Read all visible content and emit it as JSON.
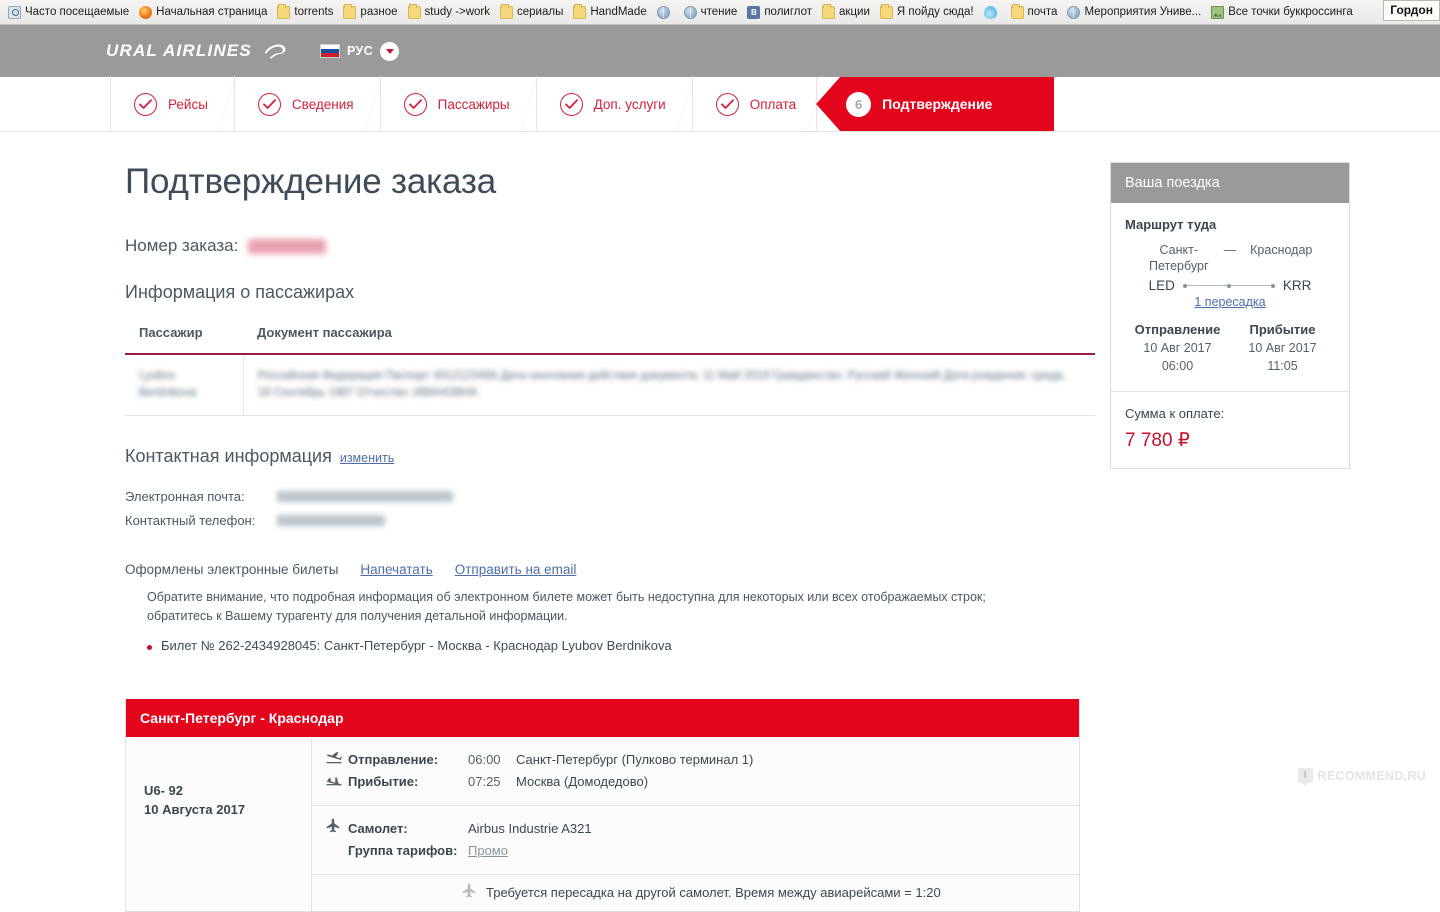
{
  "browser": {
    "bookmarks": [
      {
        "label": "Часто посещаемые",
        "icon": "frequent-icon"
      },
      {
        "label": "Начальная страница",
        "icon": "firefox-icon"
      },
      {
        "label": "torrents",
        "icon": "folder-icon"
      },
      {
        "label": "разное",
        "icon": "folder-icon"
      },
      {
        "label": "study ->work",
        "icon": "folder-icon"
      },
      {
        "label": "сериалы",
        "icon": "folder-icon"
      },
      {
        "label": "HandMade",
        "icon": "folder-icon"
      },
      {
        "label": "",
        "icon": "globe-icon"
      },
      {
        "label": "чтение",
        "icon": "globe-icon"
      },
      {
        "label": "полиглот",
        "icon": "vk-icon"
      },
      {
        "label": "акции",
        "icon": "folder-icon"
      },
      {
        "label": "Я пойду сюда!",
        "icon": "folder-icon"
      },
      {
        "label": "",
        "icon": "drop-icon"
      },
      {
        "label": "почта",
        "icon": "folder-icon"
      },
      {
        "label": "Мероприятия Униве...",
        "icon": "globe-icon"
      },
      {
        "label": "Все точки буккроссинга",
        "icon": "picture-icon"
      }
    ],
    "tooltip": "Гордон"
  },
  "header": {
    "brand": "URAL AIRLINES",
    "language": "РУС"
  },
  "steps": [
    {
      "label": "Рейсы",
      "state": "done"
    },
    {
      "label": "Сведения",
      "state": "done"
    },
    {
      "label": "Пассажиры",
      "state": "done"
    },
    {
      "label": "Доп. услуги",
      "state": "done"
    },
    {
      "label": "Оплата",
      "state": "done"
    },
    {
      "label": "Подтверждение",
      "state": "active",
      "number": "6"
    }
  ],
  "main": {
    "title": "Подтверждение заказа",
    "order_number_label": "Номер заказа:",
    "order_number_value": "",
    "passengers_heading": "Информация о пассажирах",
    "passengers_table": {
      "columns": [
        "Пассажир",
        "Документ пассажира"
      ],
      "rows": [
        {
          "passenger": "",
          "document": ""
        }
      ]
    },
    "contact_heading": "Контактная информация",
    "contact_edit_link": "изменить",
    "contact_rows": [
      {
        "label": "Электронная почта:",
        "value": ""
      },
      {
        "label": "Контактный телефон:",
        "value": ""
      }
    ],
    "eticket_text": "Оформлены электронные билеты",
    "eticket_print_link": "Напечатать",
    "eticket_email_link": "Отправить на email",
    "eticket_note": "Обратите внимание, что подробная информация об электронном билете может быть недоступна для некоторых или всех отображаемых строк; обратитесь к Вашему турагенту для получения детальной информации.",
    "ticket_line": "Билет № 262-2434928045:  Санкт-Петербург - Москва - Краснодар   Lyubov Berdnikova"
  },
  "segment": {
    "title": "Санкт-Петербург - Краснодар",
    "flight_number": "U6- 92",
    "flight_date": "10 Августа 2017",
    "departure_label": "Отправление:",
    "departure_time": "06:00",
    "departure_place": "Санкт-Петербург (Пулково терминал 1)",
    "arrival_label": "Прибытие:",
    "arrival_time": "07:25",
    "arrival_place": "Москва (Домодедово)",
    "aircraft_label": "Самолет:",
    "aircraft_value": "Airbus Industrie A321",
    "fare_label": "Группа тарифов:",
    "fare_value": "Промо",
    "transfer_note": "Требуется пересадка на другой самолет. Время между авиарейсами = 1:20"
  },
  "aside": {
    "panel_title": "Ваша поездка",
    "route_label": "Маршрут туда",
    "from_city": "Санкт-Петербург",
    "dash": "—",
    "to_city": "Краснодар",
    "from_code": "LED",
    "to_code": "KRR",
    "stops_link": "1 пересадка",
    "departure_heading": "Отправление",
    "departure_date": "10 Авг 2017",
    "departure_time": "06:00",
    "arrival_heading": "Прибытие",
    "arrival_date": "10 Авг 2017",
    "arrival_time": "11:05",
    "total_label": "Сумма к оплате:",
    "total_value": "7 780 ₽"
  },
  "watermark": {
    "badge": "I",
    "text": "RECOMMEND.RU"
  },
  "colors": {
    "brand_red": "#e3051b",
    "accent_red": "#c4122f",
    "header_gray": "#9a9a9a",
    "text_dark": "#3a4752",
    "link_blue": "#4d6fa8"
  }
}
